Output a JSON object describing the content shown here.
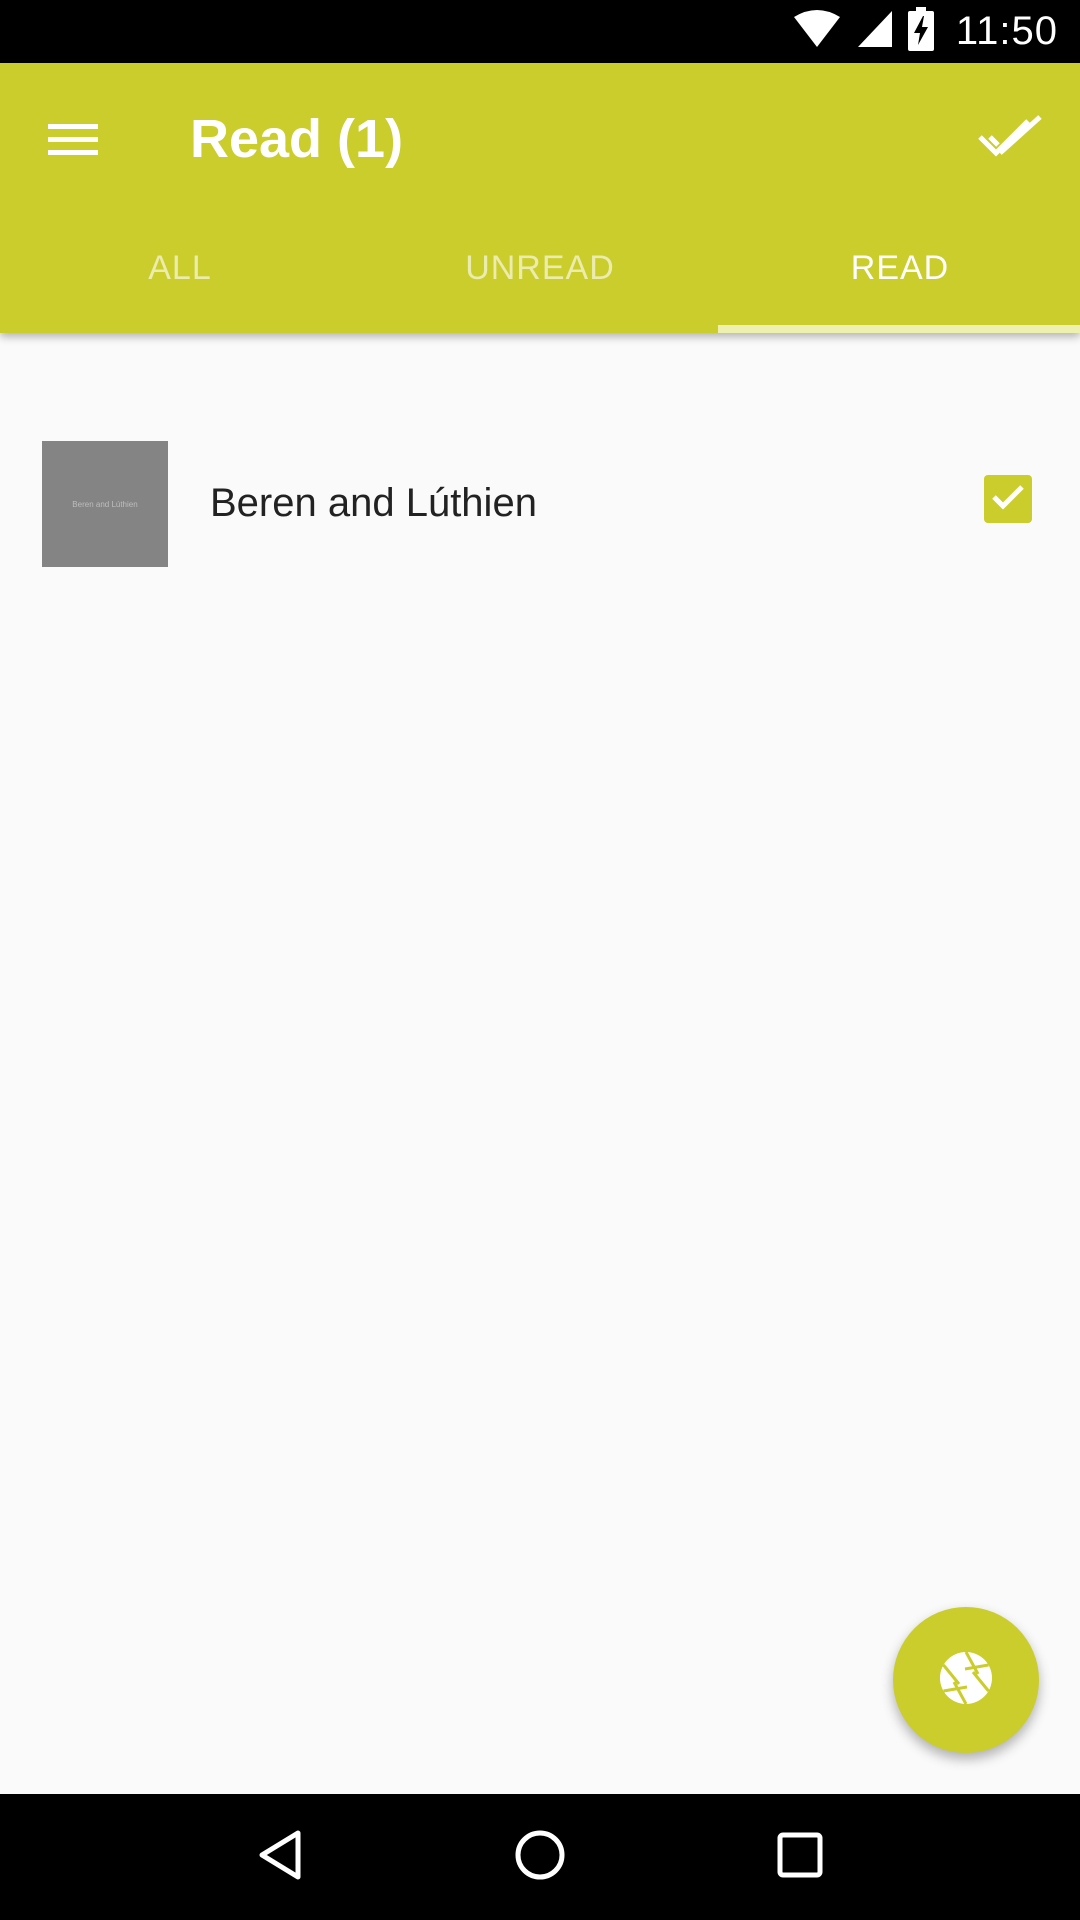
{
  "status_bar": {
    "time": "11:50",
    "icons": [
      "wifi-icon",
      "cell-signal-icon",
      "battery-charging-icon"
    ]
  },
  "app_bar": {
    "title": "Read (1)",
    "menu_icon": "hamburger-menu-icon",
    "action_icon": "done-all-icon",
    "background_color": "#cacd2b"
  },
  "tabs": [
    {
      "label": "ALL",
      "active": false
    },
    {
      "label": "UNREAD",
      "active": false
    },
    {
      "label": "READ",
      "active": true
    }
  ],
  "books": [
    {
      "title": "Beren and Lúthien",
      "cover_text": "Beren and Lúthien",
      "read": true
    }
  ],
  "fab": {
    "icon": "camera-aperture-icon"
  },
  "nav_bar": {
    "icons": [
      "back-icon",
      "home-icon",
      "recents-icon"
    ]
  }
}
